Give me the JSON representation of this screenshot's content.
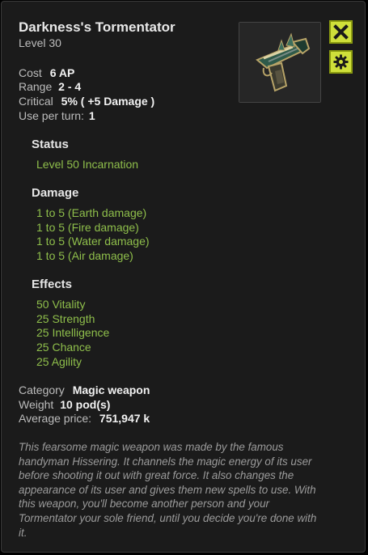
{
  "item": {
    "name": "Darkness's Tormentator",
    "level": "Level  30"
  },
  "stats": {
    "cost_label": "Cost",
    "cost_value": "6 AP",
    "range_label": "Range",
    "range_value": "2 - 4",
    "critical_label": "Critical",
    "critical_value": "5% ( +5 Damage )",
    "use_label": "Use per turn:",
    "use_value": "1"
  },
  "status": {
    "heading": "Status",
    "items": [
      "Level 50 Incarnation"
    ]
  },
  "damage": {
    "heading": "Damage",
    "items": [
      "1 to 5 (Earth damage)",
      "1 to 5 (Fire damage)",
      "1 to 5 (Water damage)",
      "1 to 5 (Air damage)"
    ]
  },
  "effects": {
    "heading": "Effects",
    "items": [
      "50 Vitality",
      "25 Strength",
      "25 Intelligence",
      "25 Chance",
      "25 Agility"
    ]
  },
  "info": {
    "category_label": "Category",
    "category_value": "Magic weapon",
    "weight_label": "Weight",
    "weight_value": "10 pod(s)",
    "price_label": "Average price:",
    "price_value": "751,947 k"
  },
  "description": "This fearsome magic weapon was made by the famous handyman Hissering. It channels the magic energy of its user before shooting it out with great force. It also changes the appearance of its user and gives them new spells to use. With this weapon, you'll become another person and your Tormentator your sole friend, until you decide you're done with it.",
  "icons": {
    "close": "close-icon",
    "settings": "gear-icon",
    "item": "weapon-icon"
  },
  "colors": {
    "accent_button": "#cfe03a",
    "effect_green": "#8fbf4b",
    "panel_bg": "#1b1b1b"
  }
}
